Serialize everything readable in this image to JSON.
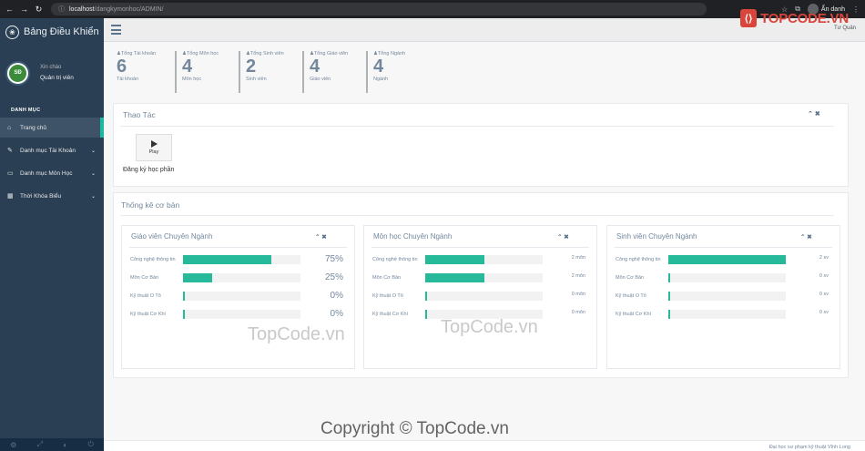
{
  "browser": {
    "url_host": "localhost",
    "url_path": "/dangkymonhoc/ADMIN/",
    "profile_label": "Ẩn danh"
  },
  "brand": {
    "title": "Bảng Điều Khiển",
    "watermark": "TOPCODE.VN"
  },
  "profile": {
    "greeting": "Xin chào",
    "name": "Quản trị viên",
    "avatar_text": "SĐ"
  },
  "sidebar": {
    "section": "DANH MỤC",
    "items": [
      {
        "label": "Trang chủ",
        "icon": "home-icon",
        "glyph": "⌂",
        "active": true,
        "chevron": ""
      },
      {
        "label": "Danh mục Tài Khoản",
        "icon": "edit-icon",
        "glyph": "✎",
        "active": false,
        "chevron": "⌄"
      },
      {
        "label": "Danh mục Môn Học",
        "icon": "desktop-icon",
        "glyph": "▭",
        "active": false,
        "chevron": "⌄"
      },
      {
        "label": "Thời Khóa Biểu",
        "icon": "table-icon",
        "glyph": "▦",
        "active": false,
        "chevron": "⌄"
      }
    ]
  },
  "topnav": {
    "user": "Tư Quản"
  },
  "tiles": [
    {
      "caption": "Tổng Tài khoản",
      "value": "6",
      "sub": "Tài khoản"
    },
    {
      "caption": "Tổng Môn học",
      "value": "4",
      "sub": "Môn học"
    },
    {
      "caption": "Tổng Sinh viên",
      "value": "2",
      "sub": "Sinh viên"
    },
    {
      "caption": "Tổng Giáo viên",
      "value": "4",
      "sub": "Giáo viên"
    },
    {
      "caption": "Tổng Ngành",
      "value": "4",
      "sub": "Ngành"
    }
  ],
  "actions": {
    "title": "Thao Tác",
    "play_label": "Play",
    "register_label": "Đăng ký học phần"
  },
  "stats": {
    "title": "Thống kê cơ bản",
    "panels": [
      {
        "title": "Giáo viên Chuyên Ngành",
        "rows": [
          {
            "label": "Công nghệ thông tin",
            "fraction": 0.75,
            "value": "75%"
          },
          {
            "label": "Môn Cơ Bản",
            "fraction": 0.25,
            "value": "25%"
          },
          {
            "label": "Kỹ thuật Ô Tô",
            "fraction": 0.0,
            "value": "0%"
          },
          {
            "label": "Kỹ thuật Cơ Khí",
            "fraction": 0.0,
            "value": "0%"
          }
        ]
      },
      {
        "title": "Môn học Chuyên Ngành",
        "rows": [
          {
            "label": "Công nghệ thông tin",
            "fraction": 0.5,
            "value": "2 môn"
          },
          {
            "label": "Môn Cơ Bản",
            "fraction": 0.5,
            "value": "2 môn"
          },
          {
            "label": "Kỹ thuật Ô Tô",
            "fraction": 0.0,
            "value": "0 môn"
          },
          {
            "label": "Kỹ thuật Cơ Khí",
            "fraction": 0.0,
            "value": "0 môn"
          }
        ]
      },
      {
        "title": "Sinh viên Chuyên Ngành",
        "rows": [
          {
            "label": "Công nghệ thông tin",
            "fraction": 1.0,
            "value": "2 sv"
          },
          {
            "label": "Môn Cơ Bản",
            "fraction": 0.0,
            "value": "0 sv"
          },
          {
            "label": "Kỹ thuật Ô Tô",
            "fraction": 0.0,
            "value": "0 sv"
          },
          {
            "label": "Kỹ thuật Cơ Khí",
            "fraction": 0.0,
            "value": "0 sv"
          }
        ]
      }
    ]
  },
  "watermarks": {
    "left": "TopCode.vn",
    "right": "TopCode.vn",
    "copyright": "Copyright © TopCode.vn"
  },
  "footer": {
    "text": "Đại học sư phạm kỹ thuật Vĩnh Long"
  },
  "colors": {
    "sidebar": "#2a3f54",
    "accent": "#1abb9c",
    "bar": "#26b99a"
  }
}
